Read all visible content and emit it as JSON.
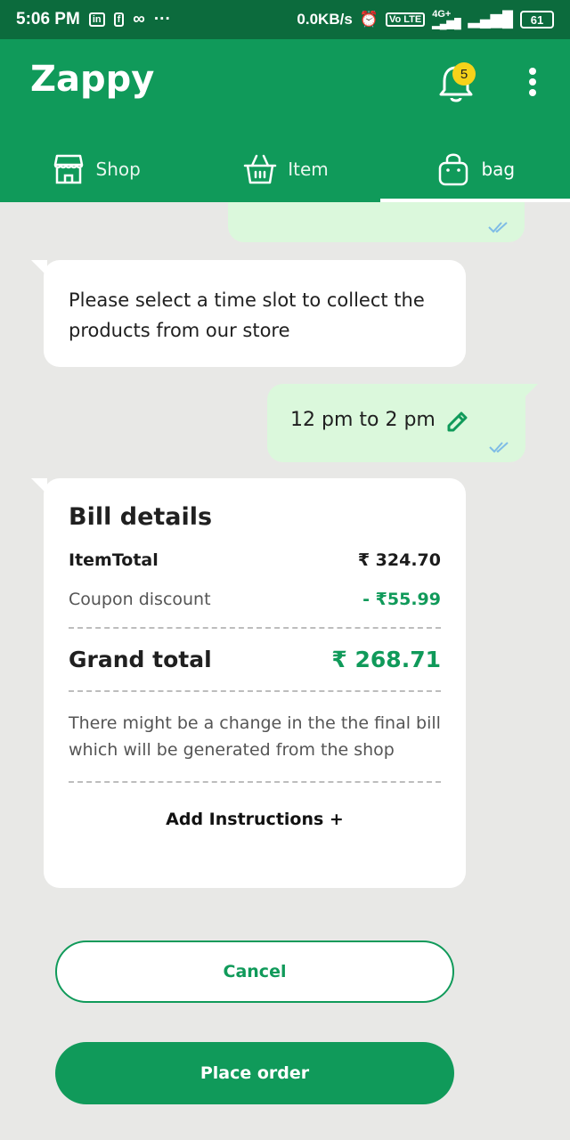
{
  "status_bar": {
    "time": "5:06 PM",
    "net_speed": "0.0KB/s",
    "battery": "61",
    "signal_label": "4G+",
    "volte": "Vo LTE",
    "icons": [
      "linkedin-icon",
      "facebook-icon",
      "infinity-icon",
      "more-dots-icon",
      "alarm-icon",
      "signal-icon",
      "battery-icon"
    ]
  },
  "header": {
    "logo": "Zappy",
    "notification_count": "5",
    "bg_color": "#109a5a"
  },
  "tabs": [
    {
      "label": "Shop",
      "icon": "store-icon"
    },
    {
      "label": "Item",
      "icon": "basket-icon"
    },
    {
      "label": "bag",
      "icon": "bag-icon",
      "active": true
    }
  ],
  "chat": {
    "time_slot_prompt": "Please select a time slot to collect the products from our store",
    "selected_slot": "12 pm to 2 pm"
  },
  "bill": {
    "title": "Bill details",
    "item_total_label": "ItemTotal",
    "item_total_value": "₹ 324.70",
    "coupon_label": "Coupon discount",
    "coupon_value": "- ₹55.99",
    "grand_label": "Grand total",
    "grand_value": "₹ 268.71",
    "note": "There might be a change in the the final bill which will be generated from the shop",
    "add_instructions": "Add Instructions +"
  },
  "actions": {
    "cancel": "Cancel",
    "place_order": "Place order"
  }
}
